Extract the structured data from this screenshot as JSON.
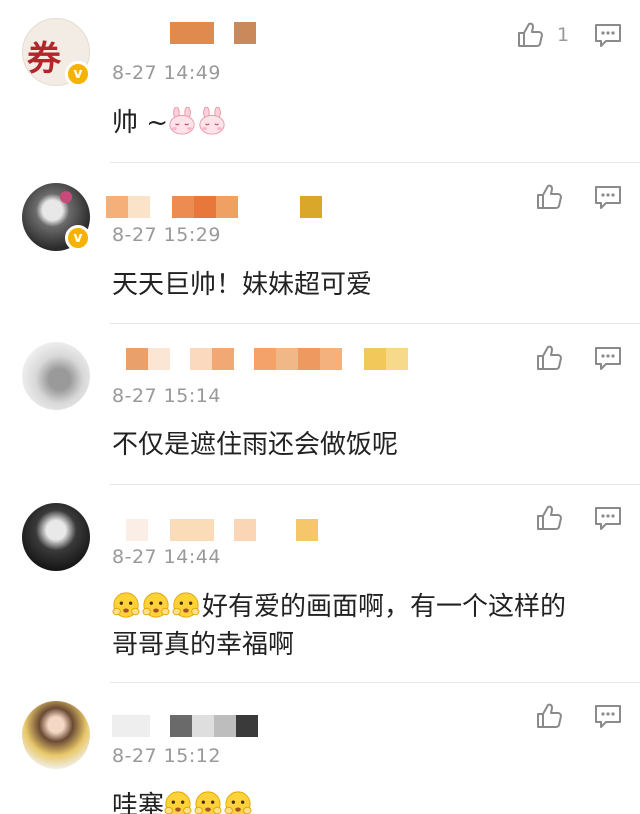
{
  "comments": [
    {
      "avatar_text": "券",
      "badge": "v",
      "time": "8-27 14:49",
      "content": "帅 ~",
      "emoji": [
        "rabbit-emoji",
        "rabbit-emoji"
      ],
      "like_count": "1"
    },
    {
      "badge": "v",
      "time": "8-27 15:29",
      "content": "天天巨帅！妹妹超可爱",
      "like_count": ""
    },
    {
      "time": "8-27 15:14",
      "content": "不仅是遮住雨还会做饭呢",
      "like_count": ""
    },
    {
      "time": "8-27 14:44",
      "content_line1": "好有爱的画面啊，有一个这样的",
      "content_line2": "哥哥真的幸福啊",
      "emoji": [
        "shy-face-emoji",
        "shy-face-emoji",
        "shy-face-emoji"
      ],
      "like_count": ""
    },
    {
      "time": "8-27 15:12",
      "content": "哇塞",
      "emoji": [
        "shy-face-emoji",
        "shy-face-emoji",
        "shy-face-emoji"
      ],
      "like_count": ""
    }
  ],
  "icons": {
    "like": "thumbs-up-icon",
    "reply": "comment-icon"
  },
  "colors": {
    "icon_gray": "#8a8a8a",
    "time_gray": "#999999",
    "badge_gold": "#f5b300"
  }
}
